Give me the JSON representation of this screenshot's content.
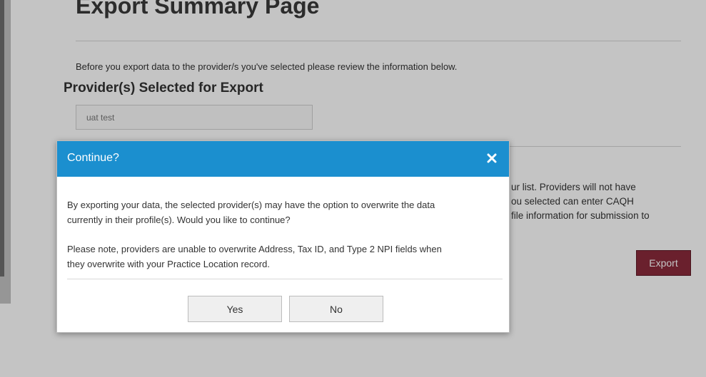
{
  "page": {
    "title": "Export Summary Page",
    "intro": "Before you export data to the provider/s you've selected please review the information below.",
    "section_heading": "Provider(s) Selected for Export",
    "provider_value": "uat test",
    "partial_paragraph": [
      "ur list. Providers will not have",
      "ou selected can enter CAQH",
      "file information for submission to"
    ],
    "export_label": "Export"
  },
  "modal": {
    "title": "Continue?",
    "close_icon": "close-icon",
    "body_line1": "By exporting your data, the selected provider(s) may have the option to overwrite the data",
    "body_line2": "currently in their profile(s). Would you like to continue?",
    "body_line3": "Please note, providers are unable to overwrite Address, Tax ID, and Type 2 NPI fields when",
    "body_line4": "they overwrite with your Practice Location record.",
    "yes_label": "Yes",
    "no_label": "No"
  },
  "colors": {
    "header_blue": "#1b8fcf",
    "export_maroon": "#8a2a3b"
  }
}
